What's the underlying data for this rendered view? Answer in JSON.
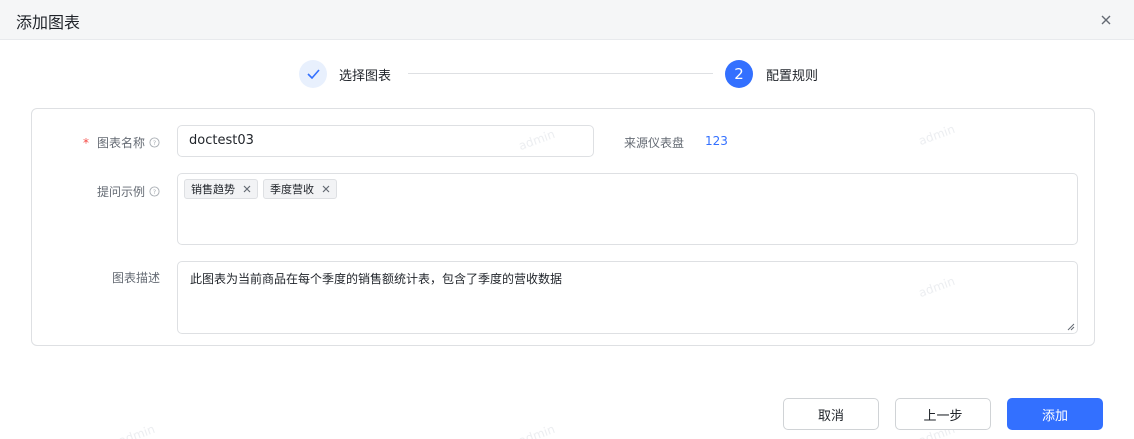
{
  "dialog": {
    "title": "添加图表",
    "close_icon": "close-icon"
  },
  "steps": [
    {
      "index": "1",
      "label": "选择图表",
      "status": "done"
    },
    {
      "index": "2",
      "label": "配置规则",
      "status": "active"
    }
  ],
  "form": {
    "chart_name": {
      "label": "图表名称",
      "value": "doctest03",
      "required": true
    },
    "source": {
      "label": "来源仪表盘",
      "value": "123"
    },
    "examples": {
      "label": "提问示例",
      "tags": [
        "销售趋势",
        "季度营收"
      ]
    },
    "description": {
      "label": "图表描述",
      "value": "此图表为当前商品在每个季度的销售额统计表，包含了季度的营收数据"
    }
  },
  "watermark": "admin",
  "buttons": {
    "cancel": "取消",
    "prev": "上一步",
    "add": "添加"
  },
  "colors": {
    "primary": "#3370ff",
    "required": "#f54a45",
    "border": "#dee0e3"
  }
}
